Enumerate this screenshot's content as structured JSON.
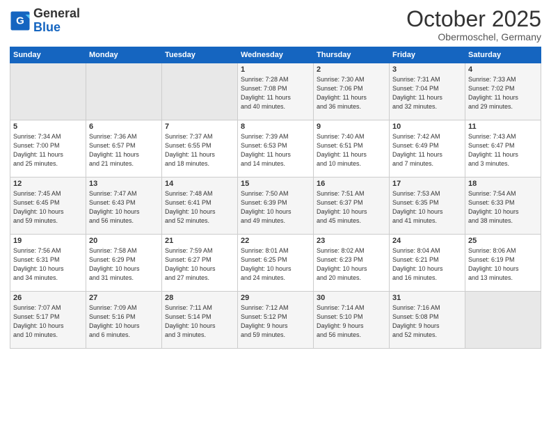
{
  "header": {
    "logo_line1": "General",
    "logo_line2": "Blue",
    "month": "October 2025",
    "location": "Obermoschel, Germany"
  },
  "weekdays": [
    "Sunday",
    "Monday",
    "Tuesday",
    "Wednesday",
    "Thursday",
    "Friday",
    "Saturday"
  ],
  "weeks": [
    [
      {
        "day": "",
        "info": ""
      },
      {
        "day": "",
        "info": ""
      },
      {
        "day": "",
        "info": ""
      },
      {
        "day": "1",
        "info": "Sunrise: 7:28 AM\nSunset: 7:08 PM\nDaylight: 11 hours\nand 40 minutes."
      },
      {
        "day": "2",
        "info": "Sunrise: 7:30 AM\nSunset: 7:06 PM\nDaylight: 11 hours\nand 36 minutes."
      },
      {
        "day": "3",
        "info": "Sunrise: 7:31 AM\nSunset: 7:04 PM\nDaylight: 11 hours\nand 32 minutes."
      },
      {
        "day": "4",
        "info": "Sunrise: 7:33 AM\nSunset: 7:02 PM\nDaylight: 11 hours\nand 29 minutes."
      }
    ],
    [
      {
        "day": "5",
        "info": "Sunrise: 7:34 AM\nSunset: 7:00 PM\nDaylight: 11 hours\nand 25 minutes."
      },
      {
        "day": "6",
        "info": "Sunrise: 7:36 AM\nSunset: 6:57 PM\nDaylight: 11 hours\nand 21 minutes."
      },
      {
        "day": "7",
        "info": "Sunrise: 7:37 AM\nSunset: 6:55 PM\nDaylight: 11 hours\nand 18 minutes."
      },
      {
        "day": "8",
        "info": "Sunrise: 7:39 AM\nSunset: 6:53 PM\nDaylight: 11 hours\nand 14 minutes."
      },
      {
        "day": "9",
        "info": "Sunrise: 7:40 AM\nSunset: 6:51 PM\nDaylight: 11 hours\nand 10 minutes."
      },
      {
        "day": "10",
        "info": "Sunrise: 7:42 AM\nSunset: 6:49 PM\nDaylight: 11 hours\nand 7 minutes."
      },
      {
        "day": "11",
        "info": "Sunrise: 7:43 AM\nSunset: 6:47 PM\nDaylight: 11 hours\nand 3 minutes."
      }
    ],
    [
      {
        "day": "12",
        "info": "Sunrise: 7:45 AM\nSunset: 6:45 PM\nDaylight: 10 hours\nand 59 minutes."
      },
      {
        "day": "13",
        "info": "Sunrise: 7:47 AM\nSunset: 6:43 PM\nDaylight: 10 hours\nand 56 minutes."
      },
      {
        "day": "14",
        "info": "Sunrise: 7:48 AM\nSunset: 6:41 PM\nDaylight: 10 hours\nand 52 minutes."
      },
      {
        "day": "15",
        "info": "Sunrise: 7:50 AM\nSunset: 6:39 PM\nDaylight: 10 hours\nand 49 minutes."
      },
      {
        "day": "16",
        "info": "Sunrise: 7:51 AM\nSunset: 6:37 PM\nDaylight: 10 hours\nand 45 minutes."
      },
      {
        "day": "17",
        "info": "Sunrise: 7:53 AM\nSunset: 6:35 PM\nDaylight: 10 hours\nand 41 minutes."
      },
      {
        "day": "18",
        "info": "Sunrise: 7:54 AM\nSunset: 6:33 PM\nDaylight: 10 hours\nand 38 minutes."
      }
    ],
    [
      {
        "day": "19",
        "info": "Sunrise: 7:56 AM\nSunset: 6:31 PM\nDaylight: 10 hours\nand 34 minutes."
      },
      {
        "day": "20",
        "info": "Sunrise: 7:58 AM\nSunset: 6:29 PM\nDaylight: 10 hours\nand 31 minutes."
      },
      {
        "day": "21",
        "info": "Sunrise: 7:59 AM\nSunset: 6:27 PM\nDaylight: 10 hours\nand 27 minutes."
      },
      {
        "day": "22",
        "info": "Sunrise: 8:01 AM\nSunset: 6:25 PM\nDaylight: 10 hours\nand 24 minutes."
      },
      {
        "day": "23",
        "info": "Sunrise: 8:02 AM\nSunset: 6:23 PM\nDaylight: 10 hours\nand 20 minutes."
      },
      {
        "day": "24",
        "info": "Sunrise: 8:04 AM\nSunset: 6:21 PM\nDaylight: 10 hours\nand 16 minutes."
      },
      {
        "day": "25",
        "info": "Sunrise: 8:06 AM\nSunset: 6:19 PM\nDaylight: 10 hours\nand 13 minutes."
      }
    ],
    [
      {
        "day": "26",
        "info": "Sunrise: 7:07 AM\nSunset: 5:17 PM\nDaylight: 10 hours\nand 10 minutes."
      },
      {
        "day": "27",
        "info": "Sunrise: 7:09 AM\nSunset: 5:16 PM\nDaylight: 10 hours\nand 6 minutes."
      },
      {
        "day": "28",
        "info": "Sunrise: 7:11 AM\nSunset: 5:14 PM\nDaylight: 10 hours\nand 3 minutes."
      },
      {
        "day": "29",
        "info": "Sunrise: 7:12 AM\nSunset: 5:12 PM\nDaylight: 9 hours\nand 59 minutes."
      },
      {
        "day": "30",
        "info": "Sunrise: 7:14 AM\nSunset: 5:10 PM\nDaylight: 9 hours\nand 56 minutes."
      },
      {
        "day": "31",
        "info": "Sunrise: 7:16 AM\nSunset: 5:08 PM\nDaylight: 9 hours\nand 52 minutes."
      },
      {
        "day": "",
        "info": ""
      }
    ]
  ]
}
